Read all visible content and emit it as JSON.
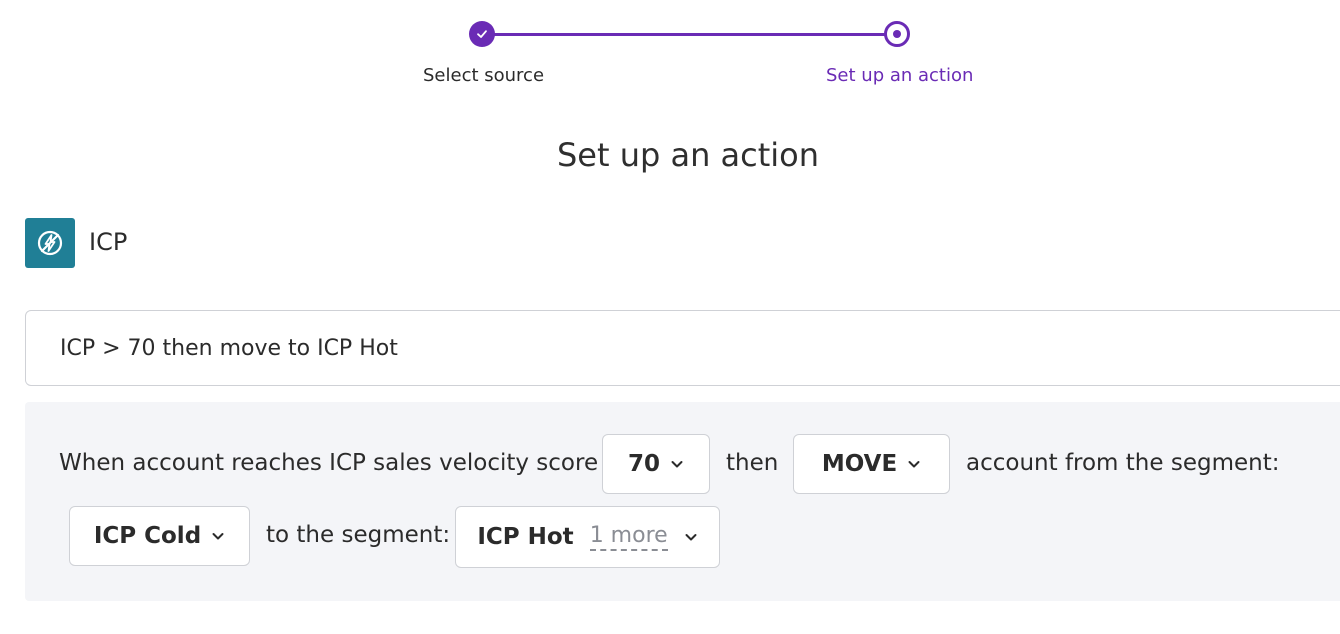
{
  "stepper": {
    "steps": [
      {
        "label": "Select source",
        "state": "completed"
      },
      {
        "label": "Set up an action",
        "state": "current"
      }
    ],
    "accent_color": "#6a2bb5"
  },
  "page_title": "Set up an action",
  "source": {
    "name": "ICP",
    "icon": "lightning-slash-icon",
    "icon_bg": "#207f96"
  },
  "rule_name": {
    "value": "ICP > 70 then move to ICP Hot"
  },
  "rule": {
    "text_when": "When account reaches ICP sales velocity score",
    "score_value": "70",
    "text_then": "then",
    "action_value": "MOVE",
    "text_from": "account from the segment:",
    "from_segment": "ICP Cold",
    "text_to": "to the segment:",
    "to_segment": "ICP Hot",
    "to_segment_more": "1 more"
  }
}
